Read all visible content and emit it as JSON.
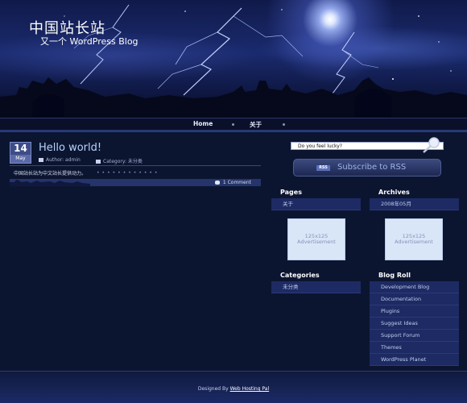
{
  "header": {
    "site_title": "中国站长站",
    "site_description": "又一个 WordPress Blog"
  },
  "nav": {
    "items": [
      {
        "label": "Home"
      },
      {
        "label": "关于"
      }
    ]
  },
  "post": {
    "day": "14",
    "month": "May",
    "title": "Hello world!",
    "author": "Author: admin",
    "category": "Category: 未分类",
    "excerpt": "中国站长站为中文站长提供动力。",
    "comments": "1 Comment"
  },
  "sidebar": {
    "search_value": "Do you feel lucky?",
    "rss_badge": "RSS",
    "rss_label": "Subscribe to RSS",
    "pages": {
      "title": "Pages",
      "items": [
        "关于"
      ]
    },
    "archives": {
      "title": "Archives",
      "items": [
        "2008年05月"
      ]
    },
    "ads": [
      {
        "line1": "125x125",
        "line2": "Advertisement"
      },
      {
        "line1": "125x125",
        "line2": "Advertisement"
      }
    ],
    "categories": {
      "title": "Categories",
      "items": [
        "未分类"
      ]
    },
    "blogroll": {
      "title": "Blog Roll",
      "items": [
        "Development Blog",
        "Documentation",
        "Plugins",
        "Suggest Ideas",
        "Support Forum",
        "Themes",
        "WordPress Planet"
      ]
    }
  },
  "footer": {
    "prefix": "Designed By ",
    "link": "Web Hosting Pal"
  }
}
